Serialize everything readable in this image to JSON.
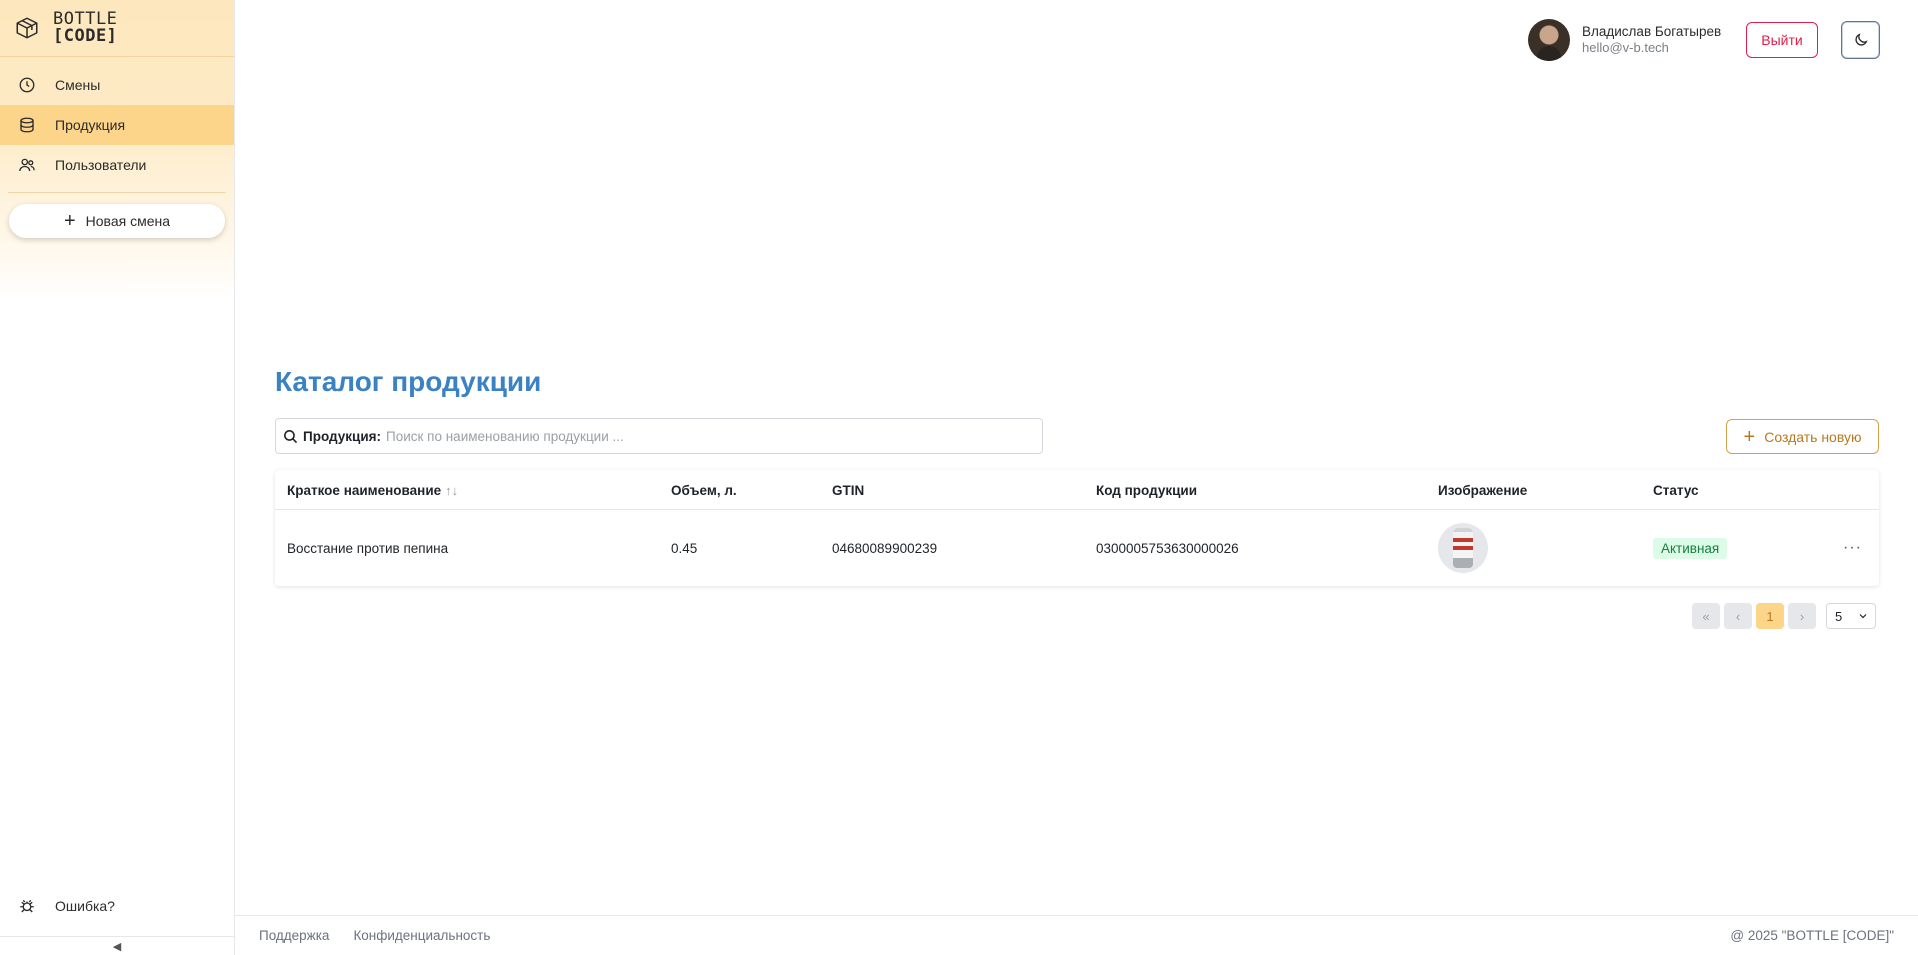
{
  "brand": {
    "line1": "BOTTLE",
    "line2": "[CODE]",
    "icon": "box-icon"
  },
  "sidebar": {
    "items": [
      {
        "label": "Смены",
        "icon": "clock-icon",
        "active": false
      },
      {
        "label": "Продукция",
        "icon": "database-icon",
        "active": true
      },
      {
        "label": "Пользователи",
        "icon": "users-icon",
        "active": false
      }
    ],
    "new_shift_label": "Новая смена",
    "error_label": "Ошибка?",
    "collapse_glyph": "◀"
  },
  "header": {
    "user_name": "Владислав Богатырев",
    "user_email": "hello@v-b.tech",
    "logout_label": "Выйти",
    "theme_icon": "moon-icon"
  },
  "main": {
    "title": "Каталог продукции",
    "search": {
      "label": "Продукция:",
      "placeholder": "Поиск по наименованию продукции ...",
      "value": ""
    },
    "create_label": "Создать новую",
    "table": {
      "columns": [
        "Краткое наименование",
        "Объем, л.",
        "GTIN",
        "Код продукции",
        "Изображение",
        "Статус"
      ],
      "sort_glyph": "↑↓",
      "rows": [
        {
          "name": "Восстание против пепина",
          "volume": "0.45",
          "gtin": "04680089900239",
          "code": "0300005753630000026",
          "image": "beer-can-thumbnail",
          "status": "Активная",
          "actions": "···"
        }
      ]
    },
    "pagination": {
      "first": "«",
      "prev": "‹",
      "current": "1",
      "next": "›",
      "page_size": "5"
    }
  },
  "footer": {
    "support": "Поддержка",
    "privacy": "Конфиденциальность",
    "copyright": "@ 2025 \"BOTTLE [CODE]\""
  },
  "colors": {
    "accent": "#fcd48a",
    "title_blue": "#3b82c4",
    "danger": "#e11d48",
    "create_orange": "#b7791f",
    "status_green": "#15803d"
  }
}
